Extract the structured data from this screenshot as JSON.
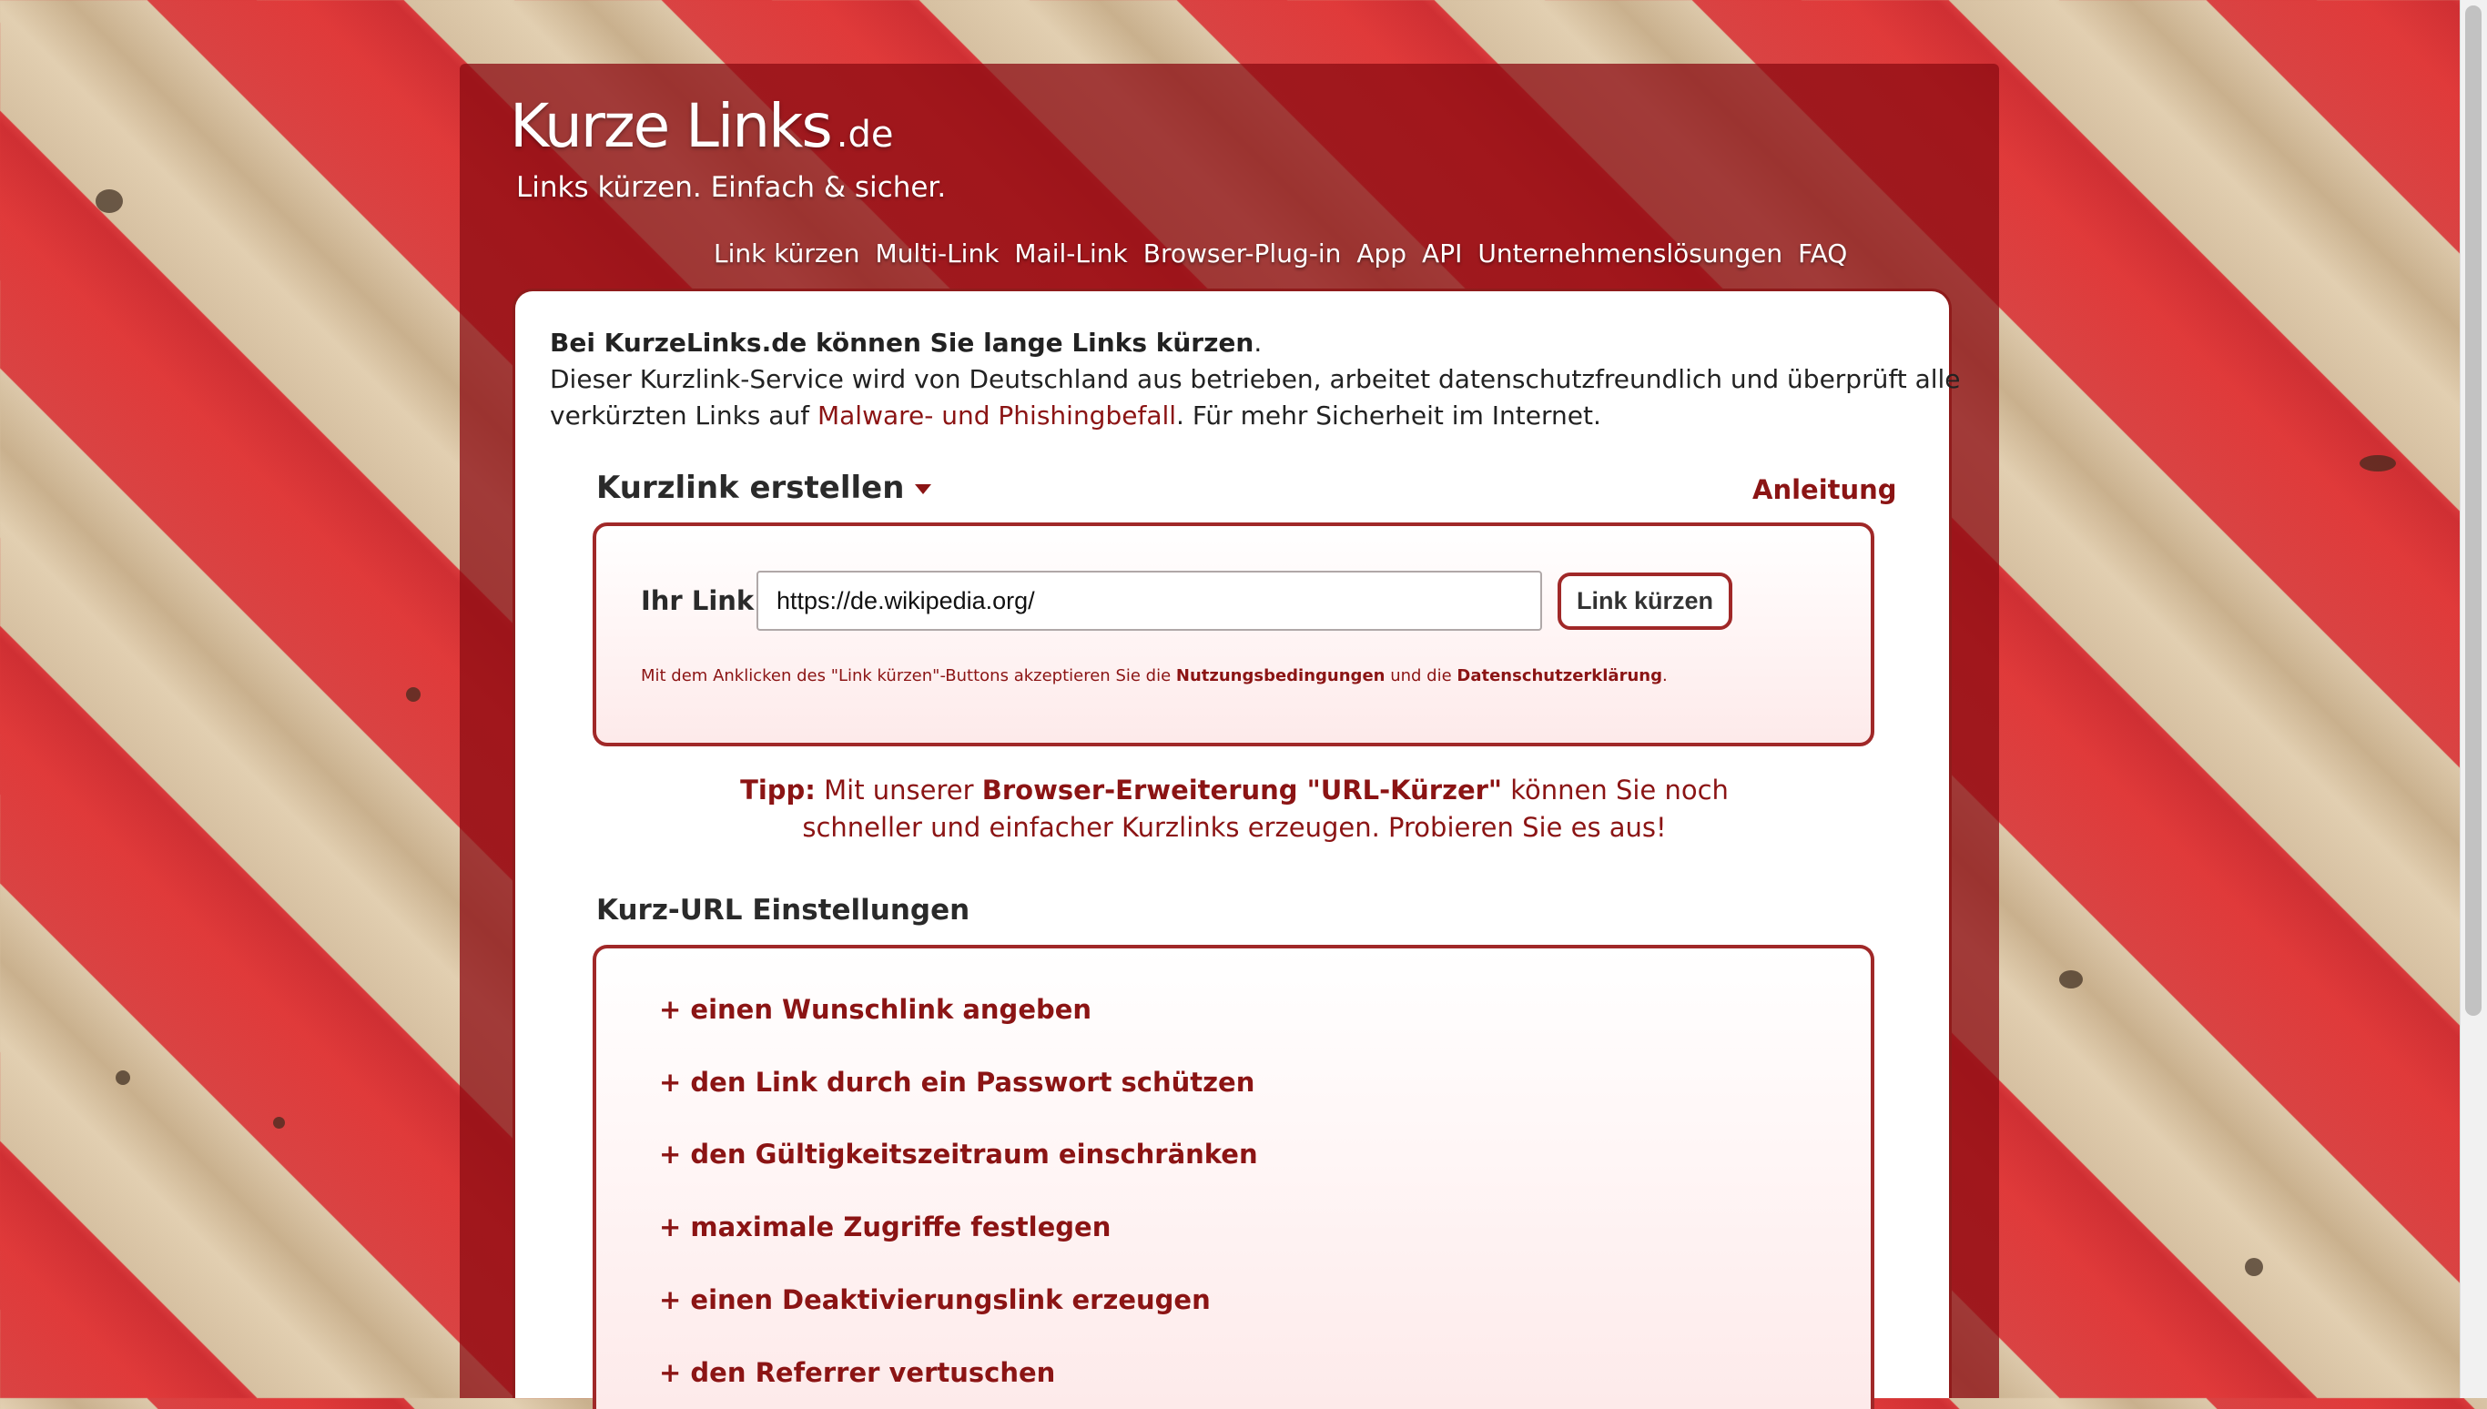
{
  "site": {
    "logo_main": "Kurze Links",
    "logo_tld": ".de",
    "tagline": "Links kürzen. Einfach & sicher."
  },
  "nav": [
    "Link kürzen",
    "Multi-Link",
    "Mail-Link",
    "Browser-Plug-in",
    "App",
    "API",
    "Unternehmenslösungen",
    "FAQ"
  ],
  "intro": {
    "bold": "Bei KurzeLinks.de können Sie lange Links kürzen",
    "bold_end": ".",
    "line2": "Dieser Kurzlink-Service wird von Deutschland aus betrieben, arbeitet datenschutzfreundlich und überprüft alle",
    "line3_pre": "verkürzten Links auf ",
    "line3_link": "Malware- und Phishingbefall",
    "line3_post": ". Für mehr Sicherheit im Internet."
  },
  "create": {
    "title": "Kurzlink erstellen",
    "guide": "Anleitung",
    "label": "Ihr Link:",
    "input_value": "https://de.wikipedia.org/",
    "button": "Link kürzen",
    "terms_pre": "Mit dem Anklicken des \"Link kürzen\"-Buttons akzeptieren Sie die ",
    "terms_link1": "Nutzungsbedingungen",
    "terms_mid": " und die ",
    "terms_link2": "Datenschutzerklärung",
    "terms_post": "."
  },
  "tip": {
    "label": "Tipp:",
    "pre": " Mit unserer ",
    "link": "Browser-Erweiterung \"URL-Kürzer\"",
    "post": " können Sie noch",
    "line2": "schneller und einfacher Kurzlinks erzeugen. Probieren Sie es aus!"
  },
  "settings": {
    "title": "Kurz-URL Einstellungen",
    "options": [
      "+ einen Wunschlink angeben",
      "+ den Link durch ein Passwort schützen",
      "+ den Gültigkeitszeitraum einschränken",
      "+ maximale Zugriffe festlegen",
      "+ einen Deaktivierungslink erzeugen",
      "+ den Referrer vertuschen"
    ]
  }
}
